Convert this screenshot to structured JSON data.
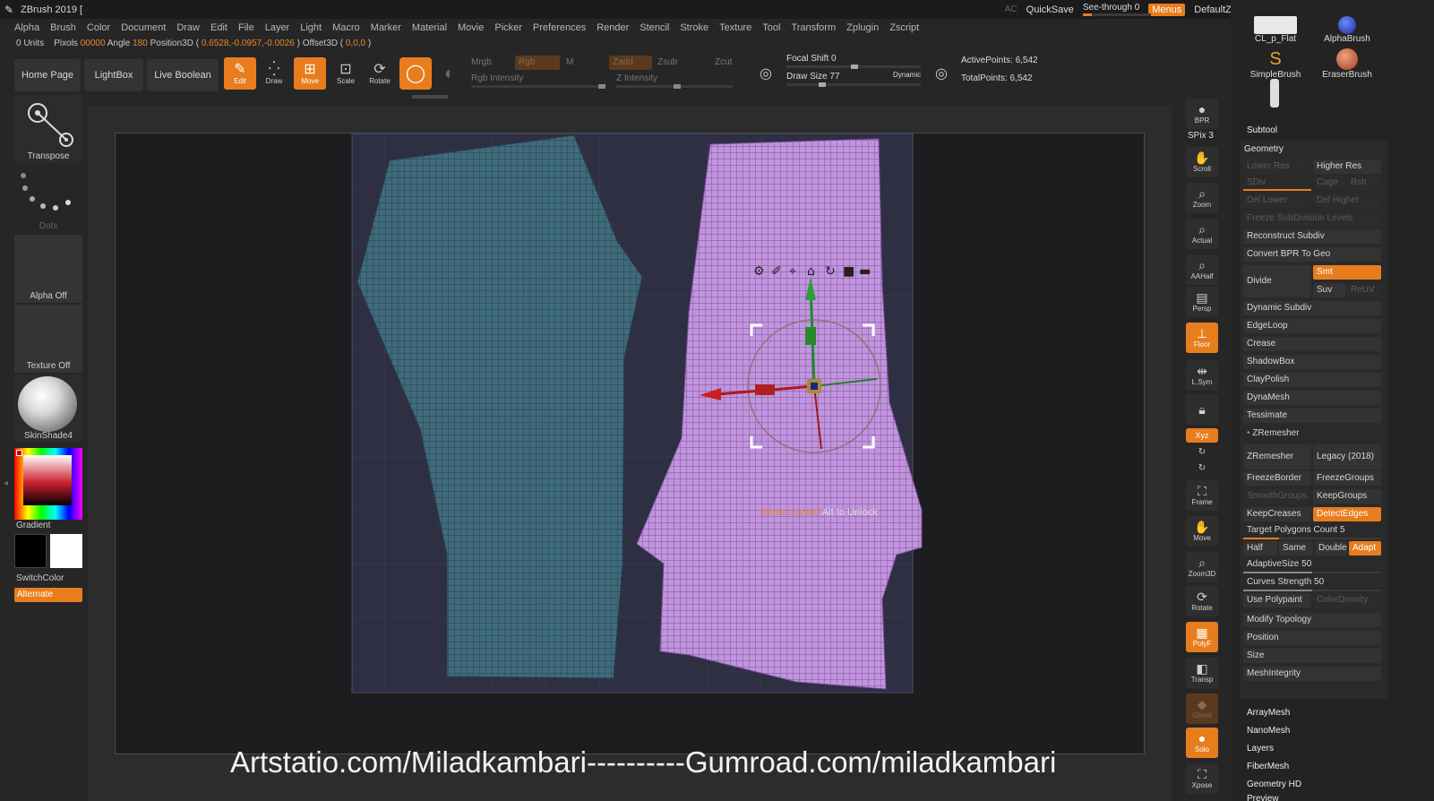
{
  "titlebar": {
    "app_title": "ZBrush 2019 [",
    "ac": "AC",
    "quicksave": "QuickSave",
    "see_through": "See-through  0",
    "menus": "Menus",
    "default_zscript": "DefaultZScript"
  },
  "menubar": [
    "Alpha",
    "Brush",
    "Color",
    "Document",
    "Draw",
    "Edit",
    "File",
    "Layer",
    "Light",
    "Macro",
    "Marker",
    "Material",
    "Movie",
    "Picker",
    "Preferences",
    "Render",
    "Stencil",
    "Stroke",
    "Texture",
    "Tool",
    "Transform",
    "Zplugin",
    "Zscript"
  ],
  "info": {
    "units": "0 Units",
    "pixols_label": "Pixols",
    "pixols_value": "00000",
    "angle_label": "Angle",
    "angle_value": "180",
    "position_label": "Position3D (",
    "position_value": " 0.6528,-0.0957,-0.0026 ",
    "offset_label": ") Offset3D (",
    "offset_value": " 0,0,0 ",
    "close": ")"
  },
  "shelf": {
    "home_page": "Home Page",
    "lightbox": "LightBox",
    "live_boolean": "Live Boolean",
    "edit": "Edit",
    "draw": "Draw",
    "move": "Move",
    "scale": "Scale",
    "rotate": "Rotate",
    "mrgb": "Mrgb",
    "rgb": "Rgb",
    "m": "M",
    "rgb_intensity": "Rgb Intensity",
    "zadd": "Zadd",
    "zsub": "Zsub",
    "zcut": "Zcut",
    "z_intensity": "Z Intensity",
    "focal_shift": "Focal Shift 0",
    "draw_size": "Draw Size 77",
    "dynamic": "Dynamic",
    "active_points": "ActivePoints: 6,542",
    "total_points": "TotalPoints: 6,542"
  },
  "lefttray": {
    "transpose": "Transpose",
    "dots": "Dots",
    "alpha_off": "Alpha Off",
    "texture_off": "Texture Off",
    "material": "SkinShade4",
    "gradient": "Gradient",
    "switchcolor": "SwitchColor",
    "alternate": "Alternate"
  },
  "canvas": {
    "lock_prefix": "Move Locked",
    "lock_suffix": "Alt to Unlock",
    "watermark": "Artstatio.com/Miladkambari----------Gumroad.com/miladkambari"
  },
  "rightstrip": {
    "bpr": "BPR",
    "spix": "SPix 3",
    "scroll": "Scroll",
    "zoom": "Zoom",
    "actual": "Actual",
    "aahalf": "AAHalf",
    "persp": "Persp",
    "floor": "Floor",
    "lsym": "L.Sym",
    "xyz": "Xyz",
    "frame": "Frame",
    "move": "Move",
    "zoom3d": "Zoom3D",
    "rotate": "Rotate",
    "polyf": "PolyF",
    "transp": "Transp",
    "ghost": "Ghost",
    "solo": "Solo",
    "xpose": "Xpose"
  },
  "rightpanel": {
    "brushes": [
      "CL_p_Flat",
      "AlphaBrush",
      "SimpleBrush",
      "EraserBrush"
    ],
    "subtool": "Subtool",
    "geometry": "Geometry",
    "lower_res": "Lower Res",
    "higher_res": "Higher Res",
    "sdiv": "SDiv",
    "cage": "Cage",
    "rstr": "Rstr",
    "del_lower": "Del Lower",
    "del_higher": "Del Higher",
    "freeze_subdiv": "Freeze SubDivision Levels",
    "reconstruct": "Reconstruct Subdiv",
    "convert_bpr": "Convert BPR To Geo",
    "divide": "Divide",
    "smt": "Smt",
    "suv": "Suv",
    "reuv": "ReUV",
    "dynamic_subdiv": "Dynamic Subdiv",
    "edgeloop": "EdgeLoop",
    "crease": "Crease",
    "shadowbox": "ShadowBox",
    "claypolish": "ClayPolish",
    "dynamesh": "DynaMesh",
    "tessimate": "Tessimate",
    "zremesher_header": "ZRemesher",
    "zremesher": "ZRemesher",
    "legacy": "Legacy (2018)",
    "freezeborder": "FreezeBorder",
    "freezegroups": "FreezeGroups",
    "smoothgroups": "SmoothGroups",
    "keepgroups": "KeepGroups",
    "keepcreases": "KeepCreases",
    "detectedges": "DetectEdges",
    "target_poly": "Target Polygons Count 5",
    "half": "Half",
    "same": "Same",
    "double": "Double",
    "adapt": "Adapt",
    "adaptive_size": "AdaptiveSize 50",
    "curves_strength": "Curves Strength 50",
    "use_polypaint": "Use Polypaint",
    "color_density": "ColorDensity",
    "modify_topology": "Modify Topology",
    "position": "Position",
    "size": "Size",
    "meshintegrity": "MeshIntegrity",
    "arraymesh": "ArrayMesh",
    "nanomesh": "NanoMesh",
    "layers": "Layers",
    "fibermesh": "FiberMesh",
    "geometry_hd": "Geometry HD",
    "preview": "Preview"
  },
  "colors": {
    "accent": "#e87d1e",
    "mesh_teal": "#3d6a7a",
    "mesh_purple": "#b98ad4"
  }
}
